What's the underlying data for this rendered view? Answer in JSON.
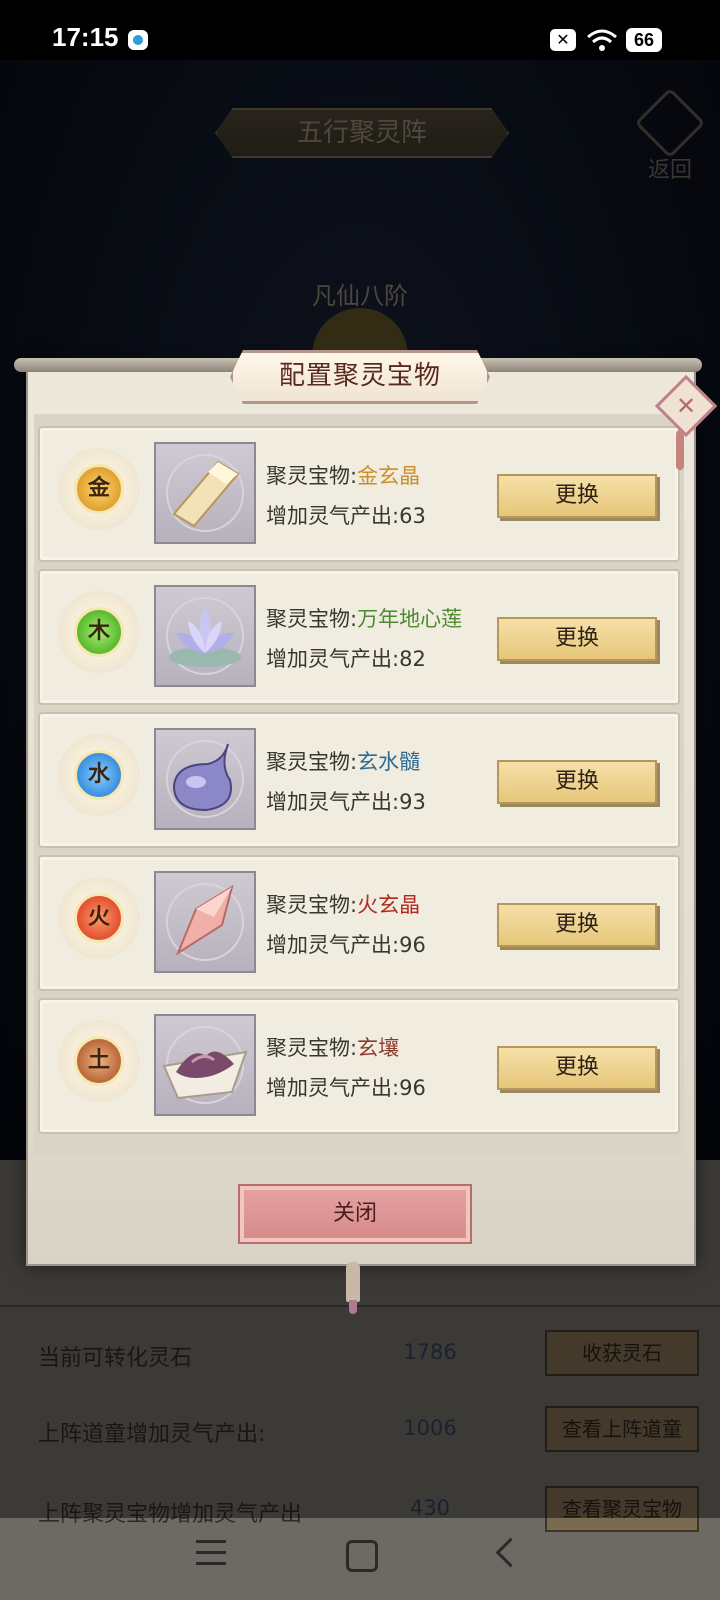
{
  "status_bar": {
    "time": "17:15",
    "battery": "66"
  },
  "background": {
    "title": "五行聚灵阵",
    "back_label": "返回",
    "rank": "凡仙八阶",
    "rows": [
      {
        "label": "当前可转化灵石",
        "value": "1786",
        "button": "收获灵石"
      },
      {
        "label": "上阵道童增加灵气产出:",
        "value": "1006",
        "button": "查看上阵道童"
      },
      {
        "label": "上阵聚灵宝物增加灵气产出",
        "value": "430",
        "button": "查看聚灵宝物"
      }
    ]
  },
  "dialog": {
    "title": "配置聚灵宝物",
    "treasure_prefix": "聚灵宝物:",
    "output_prefix": "增加灵气产出:",
    "swap_label": "更换",
    "close_label": "关闭",
    "items": [
      {
        "element": "金",
        "name": "金玄晶",
        "output": "63",
        "element_color": "#e0a030",
        "name_color": "#c8902a",
        "icon": "gold-crystal-icon"
      },
      {
        "element": "木",
        "name": "万年地心莲",
        "output": "82",
        "element_color": "#58b830",
        "name_color": "#4f8a30",
        "icon": "lotus-icon"
      },
      {
        "element": "水",
        "name": "玄水髓",
        "output": "93",
        "element_color": "#3a8ee0",
        "name_color": "#2f6a90",
        "icon": "water-drop-icon"
      },
      {
        "element": "火",
        "name": "火玄晶",
        "output": "96",
        "element_color": "#e05030",
        "name_color": "#b02a1e",
        "icon": "fire-crystal-icon"
      },
      {
        "element": "土",
        "name": "玄壤",
        "output": "96",
        "element_color": "#b8683a",
        "name_color": "#8a3a2a",
        "icon": "soil-icon"
      }
    ]
  }
}
